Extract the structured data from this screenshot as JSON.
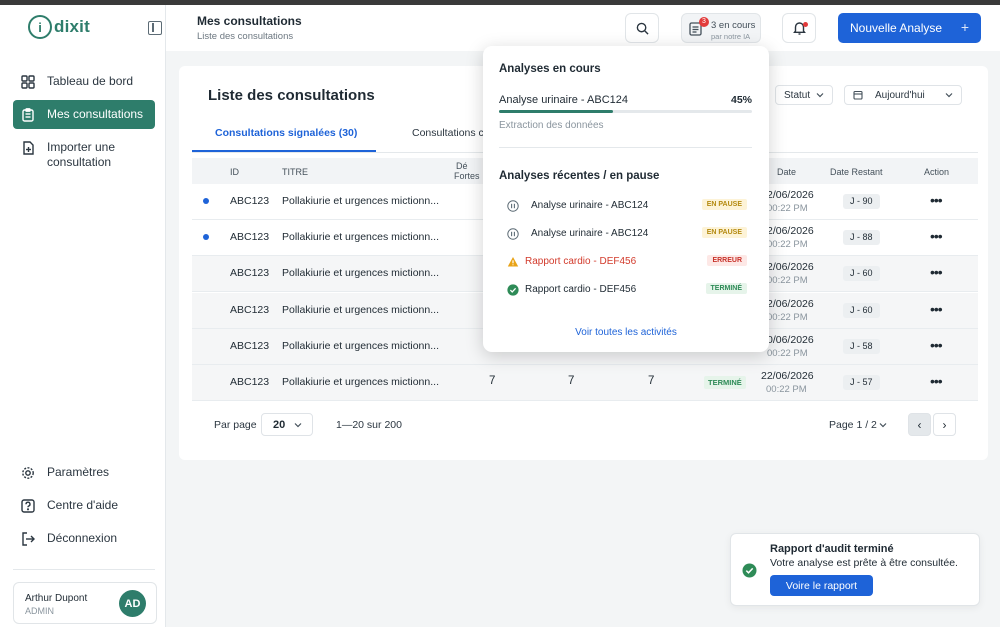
{
  "app": {
    "logo_mark": "i",
    "logo_text": "dixit"
  },
  "sidebar": {
    "items": [
      {
        "label": "Tableau de bord",
        "icon": "grid-icon"
      },
      {
        "label": "Mes consultations",
        "icon": "clipboard-icon",
        "active": true
      },
      {
        "label": "Importer une consultation",
        "icon": "file-upload-icon"
      }
    ],
    "bottom_items": [
      {
        "label": "Paramètres",
        "icon": "gear-icon"
      },
      {
        "label": "Centre d'aide",
        "icon": "help-icon"
      },
      {
        "label": "Déconnexion",
        "icon": "logout-icon"
      }
    ],
    "user": {
      "name": "Arthur Dupont",
      "role": "ADMIN",
      "initials": "AD"
    }
  },
  "header": {
    "title": "Mes consultations",
    "breadcrumb": "Liste des consultations",
    "ai_badge_count": "3",
    "ai_line1": "3 en cours",
    "ai_line2": "par notre IA",
    "new_button": "Nouvelle Analyse",
    "new_button_plus": "+"
  },
  "main": {
    "title": "Liste des consultations",
    "tabs": [
      {
        "label": "Consultations signalées (30)",
        "active": true
      },
      {
        "label": "Consultations c"
      }
    ],
    "filters": {
      "status": "Statut",
      "date": "Aujourd'hui"
    },
    "columns": {
      "id": "ID",
      "title": "TITRE",
      "fortes_top": "Dé",
      "fortes_bottom": "Fortes",
      "date": "Date",
      "date_restant": "Date Restant",
      "action": "Action"
    },
    "rows": [
      {
        "unread": true,
        "id": "ABC123",
        "title": "Pollakiurie et urgences mictionn...",
        "date": "2/06/2026",
        "time": "00:22 PM",
        "restant": "J - 90"
      },
      {
        "unread": true,
        "id": "ABC123",
        "title": "Pollakiurie et urgences mictionn...",
        "date": "2/06/2026",
        "time": "00:22 PM",
        "restant": "J - 88"
      },
      {
        "unread": false,
        "id": "ABC123",
        "title": "Pollakiurie et urgences mictionn...",
        "date": "2/06/2026",
        "time": "00:22 PM",
        "restant": "J - 60"
      },
      {
        "unread": false,
        "id": "ABC123",
        "title": "Pollakiurie et urgences mictionn...",
        "date": "2/06/2026",
        "time": "00:22 PM",
        "restant": "J - 60"
      },
      {
        "unread": false,
        "id": "ABC123",
        "title": "Pollakiurie et urgences mictionn...",
        "date": "0/06/2026",
        "time": "00:22 PM",
        "restant": "J - 58"
      },
      {
        "unread": false,
        "id": "ABC123",
        "title": "Pollakiurie et urgences mictionn...",
        "v1": "7",
        "v2": "7",
        "v3": "7",
        "status": "TERMINÉ",
        "date": "22/06/2026",
        "time": "00:22 PM",
        "restant": "J - 57"
      }
    ],
    "action_glyph": "•••",
    "pagination": {
      "per_page_label": "Par page",
      "per_page_value": "20",
      "range": "1—20 sur 200",
      "page": "Page 1 / 2",
      "prev": "‹",
      "next": "›"
    }
  },
  "popup": {
    "in_progress_title": "Analyses en cours",
    "current": {
      "name": "Analyse urinaire - ABC124",
      "percent_label": "45%",
      "progress": 0.45,
      "step": "Extraction des données"
    },
    "recent_title": "Analyses récentes / en pause",
    "recent": [
      {
        "name": "Analyse urinaire - ABC124",
        "status": "EN PAUSE",
        "kind": "pause",
        "icon": "pause-icon"
      },
      {
        "name": "Analyse urinaire - ABC124",
        "status": "EN PAUSE",
        "kind": "pause",
        "icon": "pause-icon"
      },
      {
        "name": "Rapport cardio - DEF456",
        "status": "ERREUR",
        "kind": "error",
        "icon": "warning-icon"
      },
      {
        "name": "Rapport cardio - DEF456",
        "status": "TERMINÉ",
        "kind": "done",
        "icon": "check-circle-icon"
      }
    ],
    "see_all": "Voir toutes les activités"
  },
  "toast": {
    "title": "Rapport d'audit terminé",
    "message": "Votre analyse est prête à être consultée.",
    "button": "Voire le rapport"
  },
  "colors": {
    "brand": "#2e7d6b",
    "accent": "#1e63d8",
    "error": "#d23a2b",
    "pause": "#b48a10"
  }
}
